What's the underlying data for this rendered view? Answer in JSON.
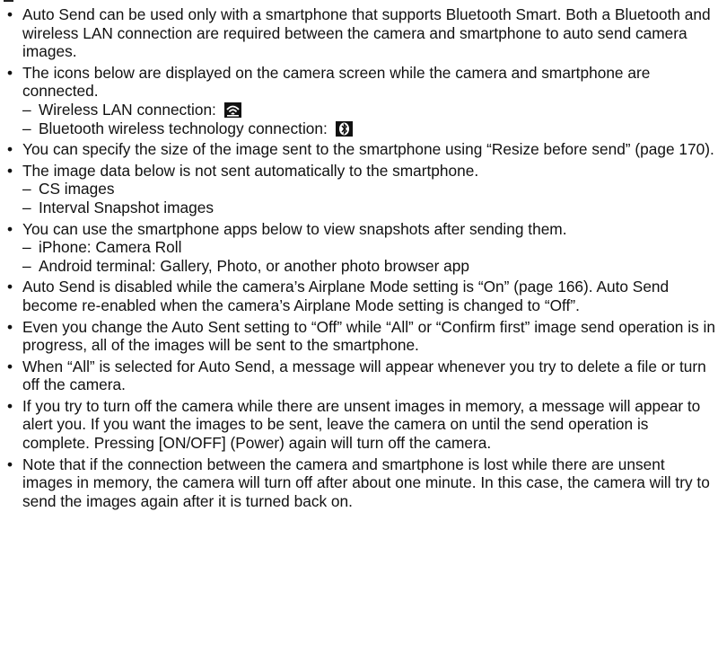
{
  "bullet_char": "•",
  "dash_char": "–",
  "notes": [
    {
      "text": "Auto Send can be used only with a smartphone that supports Bluetooth Smart. Both a Bluetooth and wireless LAN connection are required between the camera and smartphone to auto send camera images."
    },
    {
      "text": "The icons below are displayed on the camera screen while the camera and smartphone are connected.",
      "sub": [
        {
          "text": "Wireless LAN connection:",
          "icon": "wireless-lan-icon"
        },
        {
          "text": "Bluetooth wireless technology connection:",
          "icon": "bluetooth-icon"
        }
      ]
    },
    {
      "text": "You can specify the size of the image sent to the smartphone using “Resize before send” (page 170)."
    },
    {
      "text": "The image data below is not sent automatically to the smartphone.",
      "sub": [
        {
          "text": "CS images"
        },
        {
          "text": "Interval Snapshot images"
        }
      ]
    },
    {
      "text": "You can use the smartphone apps below to view snapshots after sending them.",
      "sub": [
        {
          "text": "iPhone: Camera Roll"
        },
        {
          "text": "Android terminal: Gallery, Photo, or another photo browser app"
        }
      ]
    },
    {
      "text": "Auto Send is disabled while the camera’s Airplane Mode setting is “On” (page 166). Auto Send become re-enabled when the camera’s Airplane Mode setting is changed to “Off”."
    },
    {
      "text": "Even you change the Auto Sent setting to “Off” while “All” or “Confirm first” image send operation is in progress, all of the images will be sent to the smartphone."
    },
    {
      "text": "When “All” is selected for Auto Send, a message will appear whenever you try to delete a file or turn off the camera."
    },
    {
      "text": "If you try to turn off the camera while there are unsent images in memory, a message will appear to alert you. If you want the images to be sent, leave the camera on until the send operation is complete. Pressing [ON/OFF] (Power) again will turn off the camera."
    },
    {
      "text": "Note that if the connection between the camera and smartphone is lost while there are unsent images in memory, the camera will turn off after about one minute. In this case, the camera will try to send the images again after it is turned back on."
    }
  ]
}
